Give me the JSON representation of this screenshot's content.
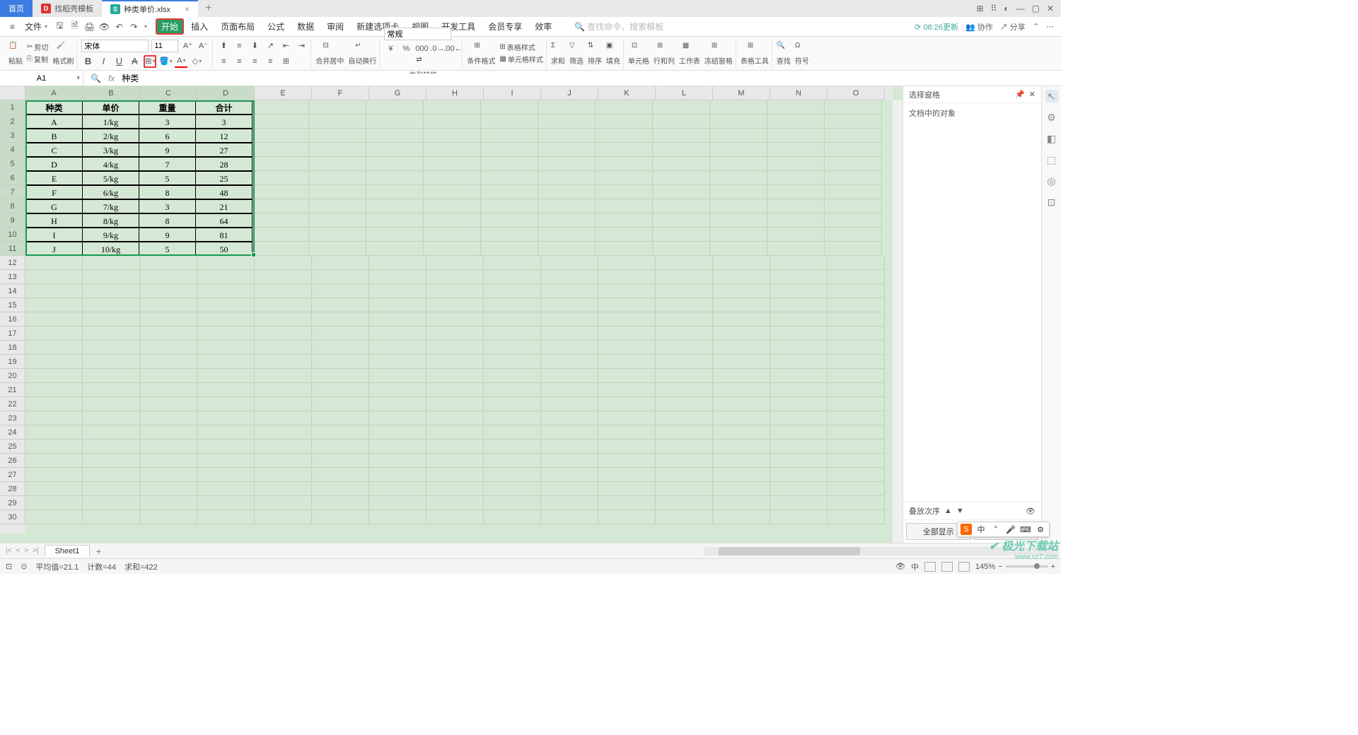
{
  "titlebar": {
    "home_tab": "首页",
    "tabs": [
      {
        "icon": "W",
        "label": "找稻壳模板"
      },
      {
        "icon": "S",
        "label": "种类单价.xlsx"
      }
    ],
    "add": "+"
  },
  "menubar": {
    "file": "文件",
    "tabs": [
      "开始",
      "插入",
      "页面布局",
      "公式",
      "数据",
      "审阅",
      "新建选项卡",
      "视图",
      "开发工具",
      "会员专享",
      "效率"
    ],
    "active_tab": "开始",
    "search_placeholder": "查找命令、搜索模板",
    "update": "08:26更新",
    "coop": "协作",
    "share": "分享"
  },
  "ribbon": {
    "paste": "粘贴",
    "cut": "剪切",
    "copy": "复制",
    "format_painter": "格式刷",
    "font_name": "宋体",
    "font_size": "11",
    "merge_center": "合并居中",
    "auto_wrap": "自动换行",
    "number_format": "常规",
    "type_convert": "类型转换",
    "cond_format": "条件格式",
    "table_style": "表格样式",
    "cell_style": "单元格样式",
    "sum": "求和",
    "filter": "筛选",
    "sort": "排序",
    "fill": "填充",
    "cell": "单元格",
    "row_col": "行和列",
    "worksheet": "工作表",
    "freeze": "冻结窗格",
    "table_tools": "表格工具",
    "find": "查找",
    "symbol": "符号"
  },
  "namebox": {
    "value": "A1"
  },
  "formula": {
    "fx": "fx",
    "value": "种类"
  },
  "grid": {
    "columns": [
      "A",
      "B",
      "C",
      "D",
      "E",
      "F",
      "G",
      "H",
      "I",
      "J",
      "K",
      "L",
      "M",
      "N",
      "O"
    ],
    "rows_visible": 30,
    "selected_cols": 4,
    "selected_rows": 11,
    "data": [
      [
        "种类",
        "单价",
        "重量",
        "合计"
      ],
      [
        "A",
        "1/kg",
        "3",
        "3"
      ],
      [
        "B",
        "2/kg",
        "6",
        "12"
      ],
      [
        "C",
        "3/kg",
        "9",
        "27"
      ],
      [
        "D",
        "4/kg",
        "7",
        "28"
      ],
      [
        "E",
        "5/kg",
        "5",
        "25"
      ],
      [
        "F",
        "6/kg",
        "8",
        "48"
      ],
      [
        "G",
        "7/kg",
        "3",
        "21"
      ],
      [
        "H",
        "8/kg",
        "8",
        "64"
      ],
      [
        "I",
        "9/kg",
        "9",
        "81"
      ],
      [
        "J",
        "10/kg",
        "5",
        "50"
      ]
    ]
  },
  "side_panel": {
    "title": "选择窗格",
    "subtitle": "文档中的对象",
    "order": "叠放次序",
    "show_all": "全部显示",
    "hide_all": "全部隐藏"
  },
  "sheets": {
    "active": "Sheet1"
  },
  "statusbar": {
    "avg_label": "平均值=",
    "avg_value": "21.1",
    "count_label": "计数=",
    "count_value": "44",
    "sum_label": "求和=",
    "sum_value": "422",
    "zoom": "145%"
  },
  "watermark": {
    "brand": "极光下载站",
    "url": "www.xz7.com"
  },
  "ime": {
    "lang": "中"
  }
}
